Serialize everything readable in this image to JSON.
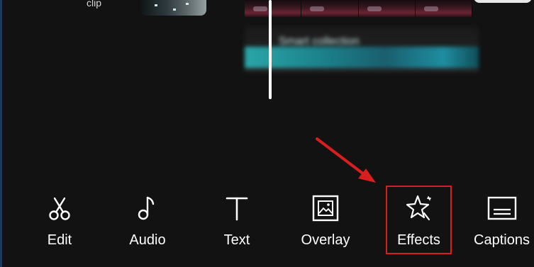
{
  "timeline": {
    "clip_label": "clip",
    "frame_count": 4,
    "text_track_label": "Smart collection"
  },
  "annotation": {
    "color": "#d81e1e",
    "target": "Effects"
  },
  "toolbar": {
    "items": [
      {
        "label": "Edit",
        "icon": "scissors-icon"
      },
      {
        "label": "Audio",
        "icon": "music-note-icon"
      },
      {
        "label": "Text",
        "icon": "text-icon"
      },
      {
        "label": "Overlay",
        "icon": "overlay-image-icon"
      },
      {
        "label": "Effects",
        "icon": "sparkle-star-icon"
      },
      {
        "label": "Captions",
        "icon": "captions-icon"
      }
    ]
  },
  "colors": {
    "background": "#121212",
    "text": "#ffffff",
    "accent_teal": "#2aa6a8"
  }
}
